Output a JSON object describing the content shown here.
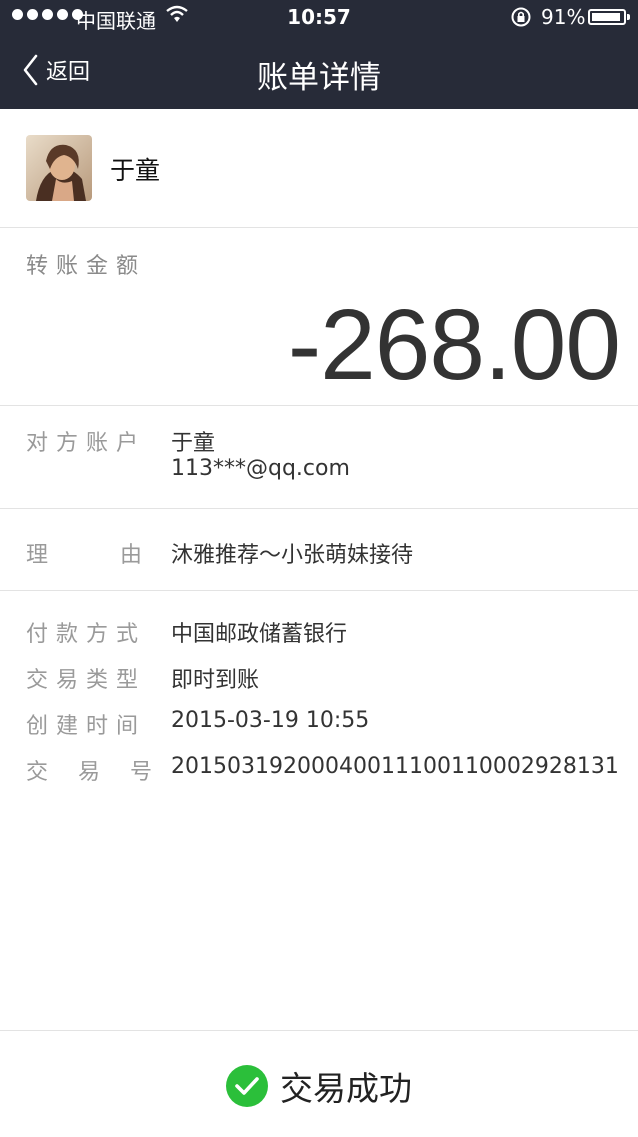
{
  "status_bar": {
    "carrier": "中国联通",
    "time": "10:57",
    "battery": "91%"
  },
  "nav": {
    "back_label": "返回",
    "title": "账单详情"
  },
  "contact": {
    "name": "于童"
  },
  "amount": {
    "label": "转账金额",
    "value": "-268.00"
  },
  "account": {
    "label": "对方账户",
    "name": "于童",
    "email": "113***@qq.com"
  },
  "reason": {
    "label": "理由",
    "value": "沐雅推荐～小张萌妹接待"
  },
  "details": [
    {
      "label": "付款方式",
      "value": "中国邮政储蓄银行"
    },
    {
      "label": "交易类型",
      "value": "即时到账"
    },
    {
      "label": "创建时间",
      "value": "2015-03-19 10:55"
    },
    {
      "label": "交易号",
      "value": "2015031920004001110011000 2928131"
    }
  ],
  "footer": {
    "status": "交易成功",
    "status_color": "#2bbf3a"
  },
  "colors": {
    "header_bg": "#272b38",
    "label_gray": "#9a9a9a"
  },
  "icons": [
    "wifi-icon",
    "rotation-lock-icon",
    "battery-icon",
    "back-chevron-icon",
    "check-circle-icon"
  ]
}
